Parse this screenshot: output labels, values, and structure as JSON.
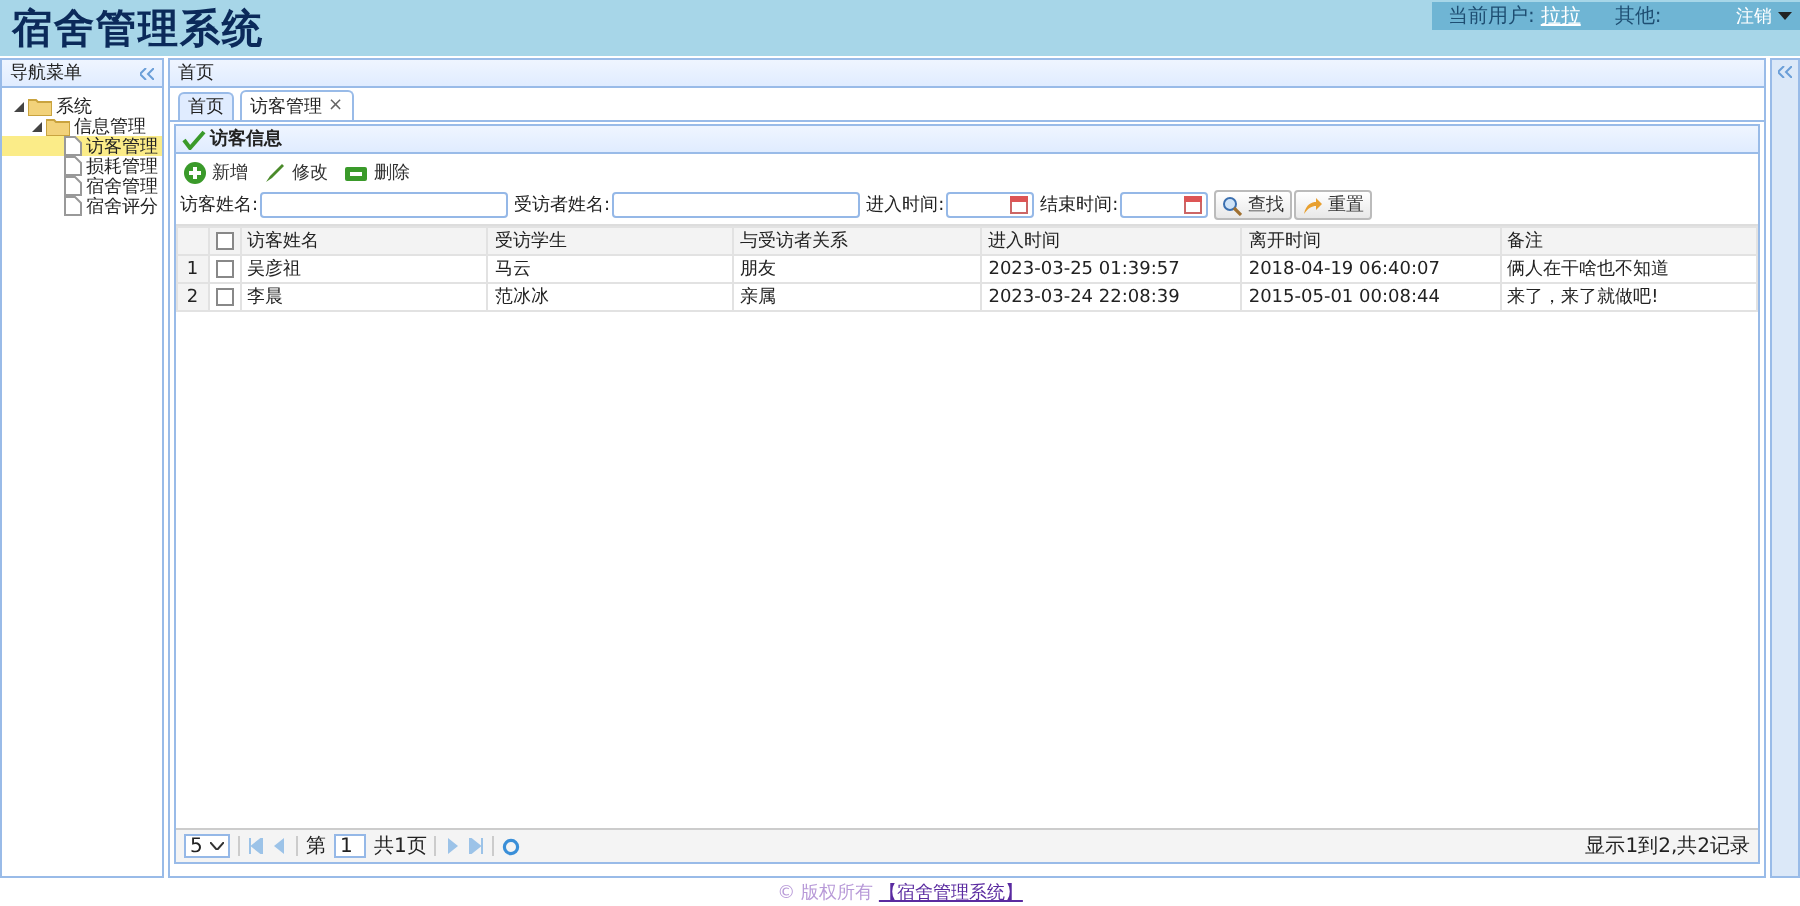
{
  "header": {
    "title": "宿舍管理系统",
    "user_label": "当前用户:",
    "user_name": "拉拉",
    "other_label": "其他:",
    "logout": "注销"
  },
  "nav": {
    "title": "导航菜单",
    "tree": [
      {
        "label": "系统",
        "expanded": true,
        "selected": false,
        "children": [
          {
            "label": "信息管理",
            "expanded": true,
            "selected": false,
            "children": [
              {
                "label": "访客管理",
                "selected": true
              },
              {
                "label": "损耗管理",
                "selected": false
              },
              {
                "label": "宿舍管理",
                "selected": false
              },
              {
                "label": "宿舍评分",
                "selected": false
              }
            ]
          }
        ]
      }
    ]
  },
  "center": {
    "title": "首页",
    "tabs": [
      {
        "label": "首页",
        "selected": false
      },
      {
        "label": "访客管理",
        "selected": true,
        "close": "×"
      }
    ],
    "panel": {
      "title": "访客信息",
      "toolbar": [
        {
          "kind": "add",
          "label": "新增"
        },
        {
          "kind": "edit",
          "label": "修改"
        },
        {
          "kind": "delete",
          "label": "删除"
        }
      ],
      "search": {
        "fields": [
          {
            "kind": "text",
            "label": "访客姓名:"
          },
          {
            "kind": "text",
            "label": "受访者姓名:"
          },
          {
            "kind": "date",
            "label": "进入时间:"
          },
          {
            "kind": "date",
            "label": "结束时间:"
          }
        ],
        "buttons": [
          {
            "kind": "search",
            "label": "查找"
          },
          {
            "kind": "reset",
            "label": "重置"
          }
        ]
      },
      "table": {
        "header_checked": false,
        "columns": [
          "访客姓名",
          "受访学生",
          "与受访者关系",
          "进入时间",
          "离开时间",
          "备注"
        ],
        "rows": [
          {
            "number": "1",
            "checked": false,
            "cells": [
              "吴彦祖",
              "马云",
              "朋友",
              "2023-03-25 01:39:57",
              "2018-04-19 06:40:07",
              "俩人在干啥也不知道"
            ]
          },
          {
            "number": "2",
            "checked": false,
            "cells": [
              "李晨",
              "范冰冰",
              "亲属",
              "2023-03-24 22:08:39",
              "2015-05-01 00:08:44",
              "来了，来了就做吧!"
            ]
          }
        ]
      },
      "pager": {
        "page_size": "5",
        "page_label": "第",
        "page": "1",
        "total_label": "共1页",
        "summary": "显示1到2,共2记录"
      }
    }
  },
  "footer": {
    "copyright": "© 版权所有",
    "link": "【宿舍管理系统】"
  }
}
